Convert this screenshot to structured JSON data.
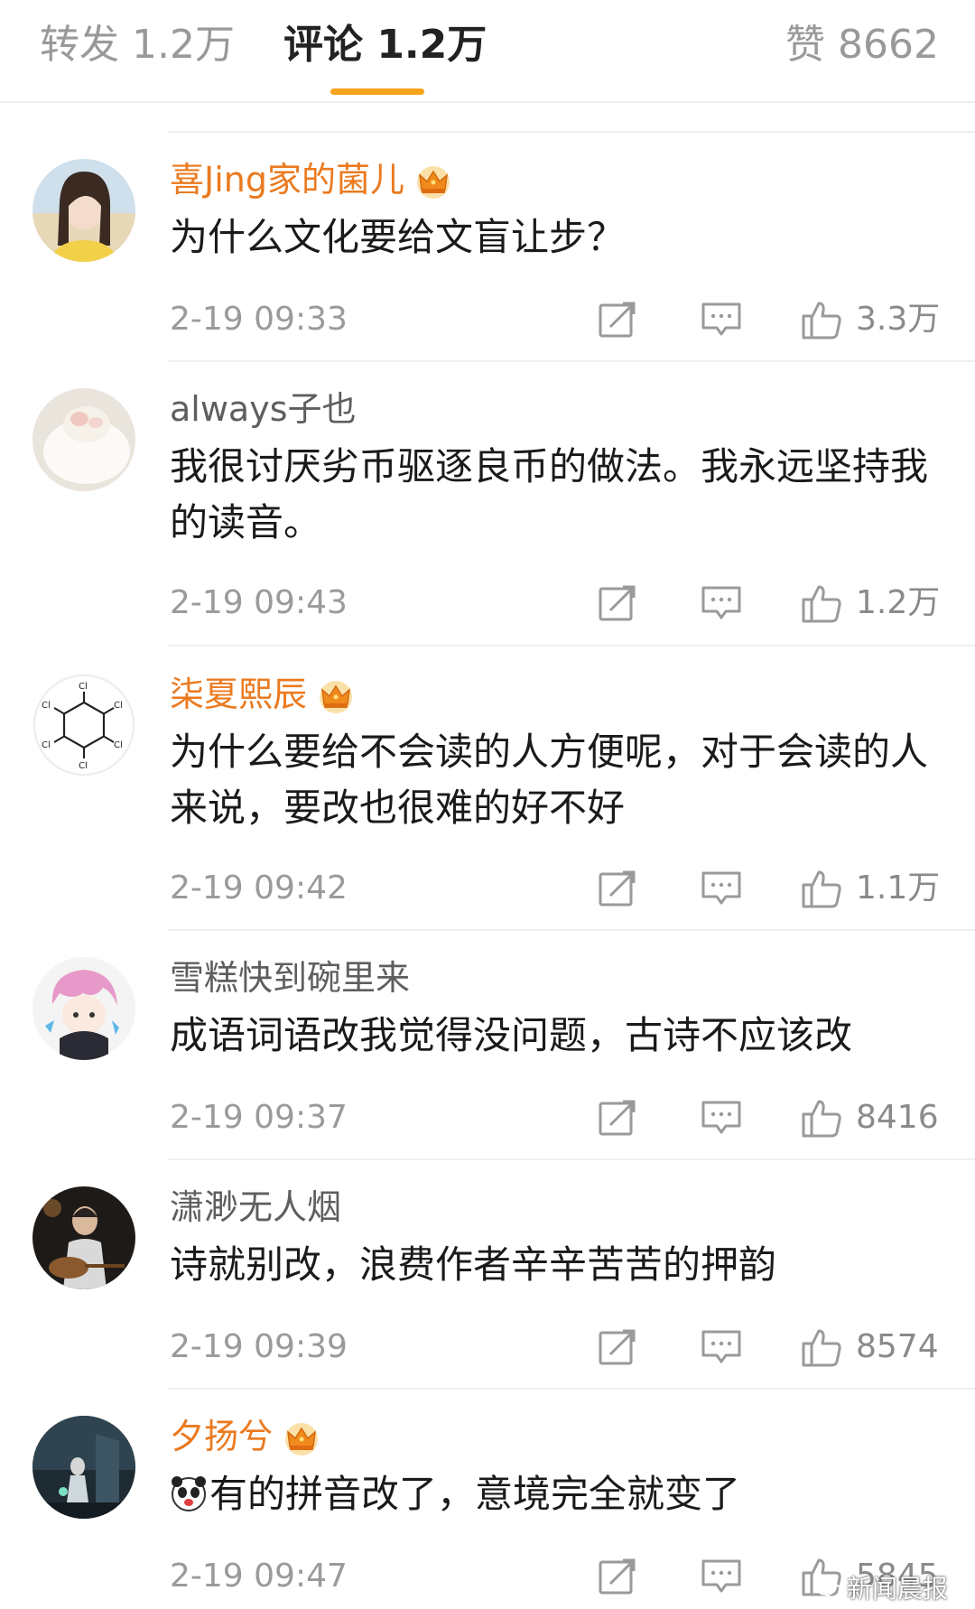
{
  "tabs": {
    "forward": "转发 1.2万",
    "comments": "评论 1.2万",
    "likes": "赞 8662"
  },
  "accent_color": "#f5a41c",
  "vip_name_color": "#eb7a1f",
  "comments": [
    {
      "username": "喜Jing家的菌儿",
      "vip": true,
      "text": "为什么文化要给文盲让步？",
      "time": "2-19 09:33",
      "likes": "3.3万"
    },
    {
      "username": "always子也",
      "vip": false,
      "text": "我很讨厌劣币驱逐良币的做法。我永远坚持我的读音。",
      "time": "2-19 09:43",
      "likes": "1.2万"
    },
    {
      "username": "柒夏熙辰",
      "vip": true,
      "text": "为什么要给不会读的人方便呢，对于会读的人来说，要改也很难的好不好",
      "time": "2-19 09:42",
      "likes": "1.1万"
    },
    {
      "username": "雪糕快到碗里来",
      "vip": false,
      "text": "成语词语改我觉得没问题，古诗不应该改",
      "time": "2-19 09:37",
      "likes": "8416"
    },
    {
      "username": "潇渺无人烟",
      "vip": false,
      "text": "诗就别改，浪费作者辛辛苦苦的押韵",
      "time": "2-19 09:39",
      "likes": "8574"
    },
    {
      "username": "夕扬兮",
      "vip": true,
      "text": "有的拼音改了，意境完全就变了",
      "time": "2-19 09:47",
      "likes": "5845",
      "emoji": "panda-face-emoji"
    }
  ],
  "icons": {
    "repost": "repost-icon",
    "reply": "comment-bubble-icon",
    "like": "thumbs-up-icon",
    "vip": "crown-icon"
  },
  "watermark": "新闻晨报"
}
